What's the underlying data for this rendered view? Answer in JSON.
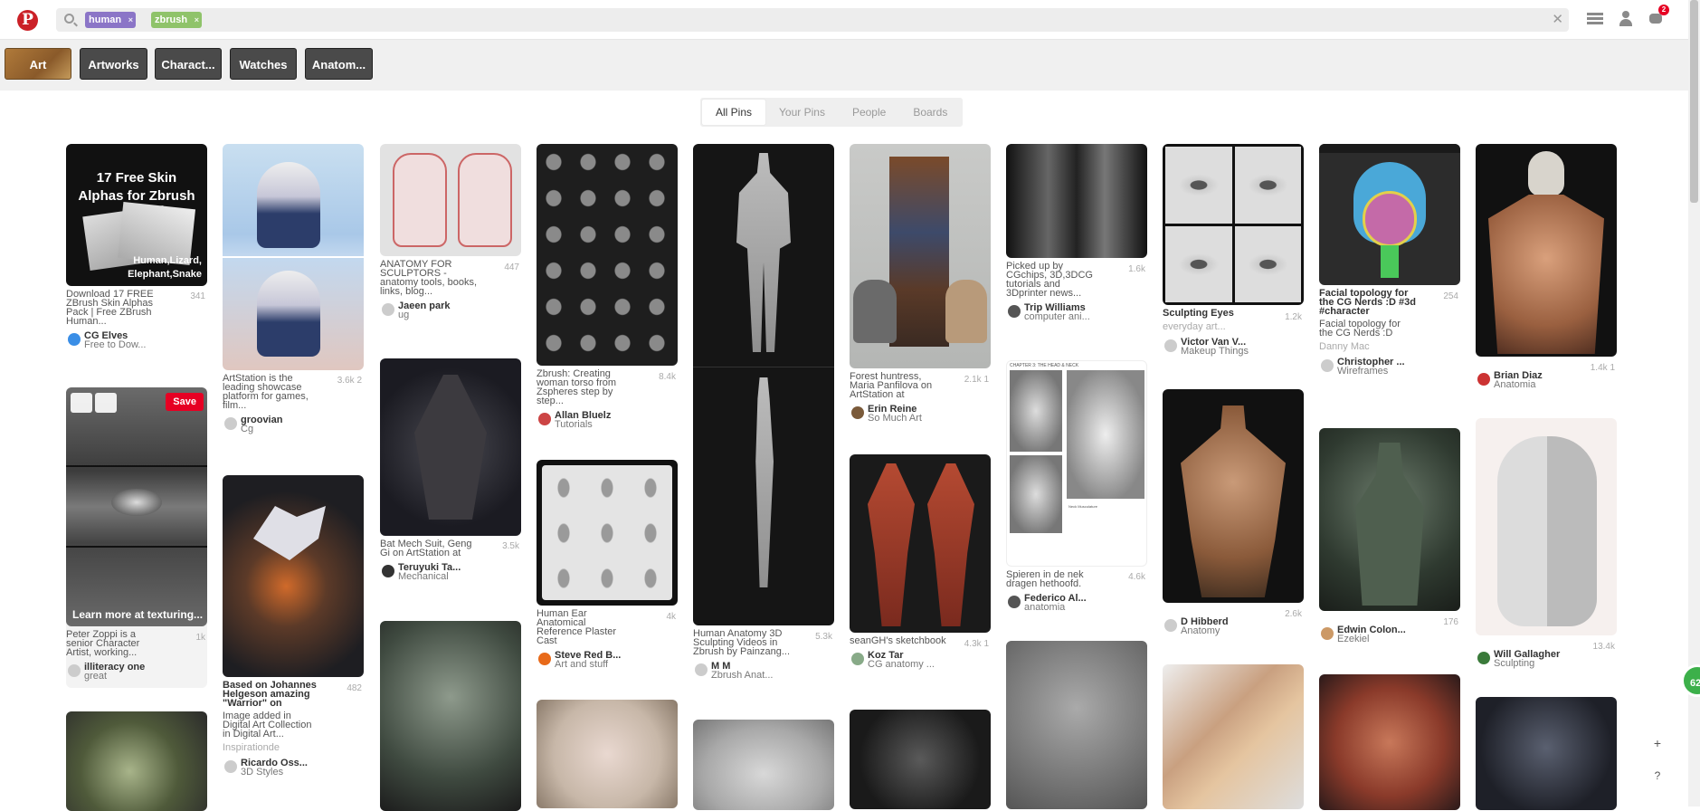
{
  "search": {
    "tokens": [
      {
        "label": "human",
        "color": "#8b75c7"
      },
      {
        "label": "zbrush",
        "color": "#8fc36a"
      }
    ],
    "remove_glyph": "×",
    "clear_glyph": "✕"
  },
  "header": {
    "logo": "P",
    "badge": "2"
  },
  "guided": [
    {
      "label": "Art"
    },
    {
      "label": "Artworks"
    },
    {
      "label": "Charact..."
    },
    {
      "label": "Watches"
    },
    {
      "label": "Anatom..."
    }
  ],
  "tabs": [
    {
      "label": "All Pins"
    },
    {
      "label": "Your Pins"
    },
    {
      "label": "People"
    },
    {
      "label": "Boards"
    }
  ],
  "pins": {
    "p1": {
      "title_line1": "17 Free Skin",
      "title_line2": "Alphas for Zbrush",
      "overlay": "Human,Lizard, Elephant,Snake",
      "desc": "Download 17 FREE ZBrush Skin Alphas Pack | Free ZBrush Human...",
      "stat": "341",
      "name": "CG Elves",
      "sub": "Free to Dow..."
    },
    "p2": {
      "desc": "Peter Zoppi is a senior Character Artist, working...",
      "stat": "1k",
      "name": "illiteracy one",
      "sub": "great",
      "save": "Save",
      "hover": "Learn more at texturing..."
    },
    "p3": {
      "desc": "ArtStation is the leading showcase platform for games, film...",
      "stat": "3.6k",
      "stat2": "2",
      "name": "groovian",
      "sub": "Cg"
    },
    "p4": {
      "desc": "Based on Johannes Helgeson amazing \"Warrior\" on",
      "desc2": "Image added in Digital Art Collection in Digital Art...",
      "stat": "482",
      "source": "Inspirationde",
      "name": "Ricardo Oss...",
      "sub": "3D Styles"
    },
    "p5": {
      "desc": "ANATOMY FOR SCULPTORS - anatomy tools, books, links, blog...",
      "stat": "447",
      "name": "Jaeen park",
      "sub": "ug"
    },
    "p6": {
      "desc": "Bat Mech Suit, Geng Gi on ArtStation at",
      "stat": "3.5k",
      "name": "Teruyuki Ta...",
      "sub": "Mechanical"
    },
    "p7": {
      "desc": "Zbrush: Creating woman torso from Zspheres step by step...",
      "stat": "8.4k",
      "name": "Allan Bluelz",
      "sub": "Tutorials"
    },
    "p8": {
      "desc": "Human Ear Anatomical Reference Plaster Cast",
      "stat": "4k",
      "name": "Steve Red B...",
      "sub": "Art and stuff"
    },
    "p9": {
      "desc": "Human Anatomy 3D Sculpting Videos in Zbrush by Painzang...",
      "stat": "5.3k",
      "name": "M M",
      "sub": "Zbrush Anat..."
    },
    "p10": {
      "desc": "Forest huntress, Maria Panfilova on ArtStation at",
      "stat": "2.1k",
      "stat2": "1",
      "name": "Erin Reine",
      "sub": "So Much Art"
    },
    "p11": {
      "desc": "seanGH's sketchbook",
      "stat": "4.3k",
      "stat2": "1",
      "name": "Koz Tar",
      "sub": "CG anatomy ..."
    },
    "p12": {
      "desc": "Picked up by CGchips, 3D,3DCG tutorials and 3Dprinter news...",
      "stat": "1.6k",
      "name": "Trip Williams",
      "sub": "computer ani..."
    },
    "p13": {
      "desc": "Spieren in de nek dragen hethoofd.",
      "stat": "4.6k",
      "name": "Federico Al...",
      "sub": "anatomia",
      "page_head": "CHAPTER 3: THE HEAD & NECK",
      "caption": "Neck Musculature"
    },
    "p14": {
      "desc": "Sculpting Eyes",
      "stat": "1.2k",
      "source": "everyday art...",
      "name": "Victor Van V...",
      "sub": "Makeup Things"
    },
    "p15": {
      "desc": "",
      "stat": "2.6k",
      "name": "D Hibberd",
      "sub": "Anatomy"
    },
    "p16": {
      "desc": "Facial topology for the CG Nerds :D #3d #character",
      "desc2": "Facial topology for the CG Nerds :D",
      "stat": "254",
      "source": "Danny Mac",
      "name": "Christopher ...",
      "sub": "Wireframes"
    },
    "p17": {
      "desc": "",
      "stat": "176",
      "name": "Edwin Colon...",
      "sub": "Ezekiel"
    },
    "p18": {
      "desc": "",
      "stat": "1.4k",
      "stat2": "1",
      "name": "Brian Diaz",
      "sub": "Anatomia"
    },
    "p19": {
      "desc": "",
      "stat": "13.4k",
      "name": "Will Gallagher",
      "sub": "Sculpting"
    }
  },
  "fab": "62",
  "side": {
    "plus": "+",
    "help": "?"
  }
}
